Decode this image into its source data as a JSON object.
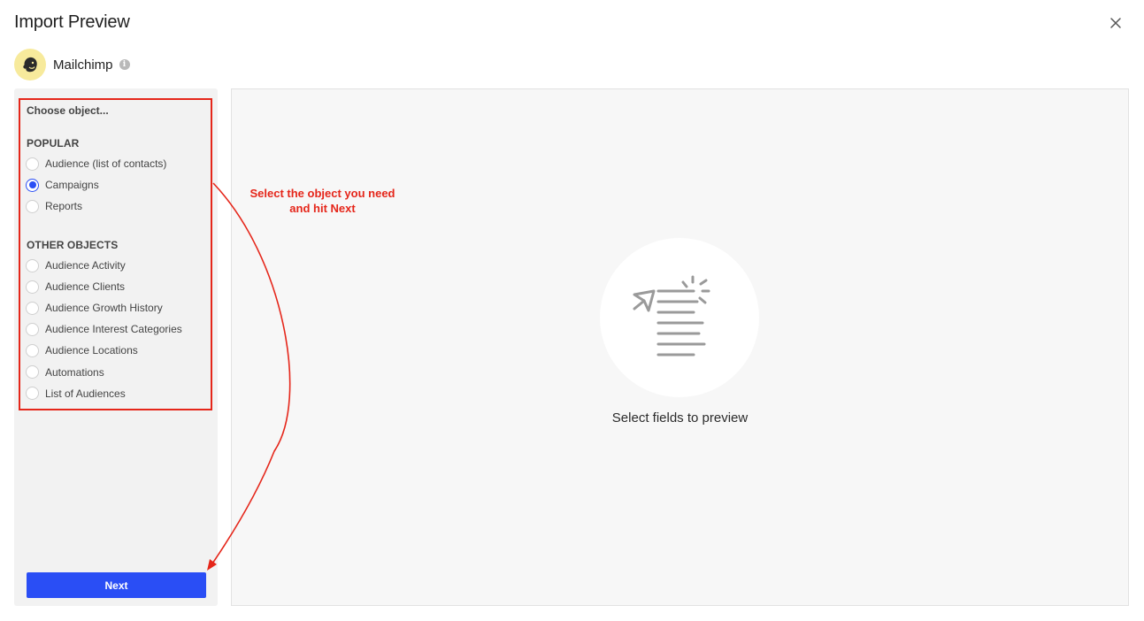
{
  "dialog": {
    "title": "Import Preview",
    "close_icon": "close-icon"
  },
  "source": {
    "name": "Mailchimp",
    "avatar_icon": "mailchimp-logo-icon",
    "info_icon": "info-icon",
    "info_glyph": "i"
  },
  "sidebar": {
    "choose_label": "Choose object...",
    "popular_heading": "POPULAR",
    "popular_options": [
      {
        "label": "Audience (list of contacts)",
        "selected": false
      },
      {
        "label": "Campaigns",
        "selected": true
      },
      {
        "label": "Reports",
        "selected": false
      }
    ],
    "other_heading": "OTHER OBJECTS",
    "other_options": [
      {
        "label": "Audience Activity",
        "selected": false
      },
      {
        "label": "Audience Clients",
        "selected": false
      },
      {
        "label": "Audience Growth History",
        "selected": false
      },
      {
        "label": "Audience Interest Categories",
        "selected": false
      },
      {
        "label": "Audience Locations",
        "selected": false
      },
      {
        "label": "Automations",
        "selected": false
      },
      {
        "label": "List of Audiences",
        "selected": false
      }
    ],
    "next_label": "Next"
  },
  "preview": {
    "empty_icon": "document-send-icon",
    "empty_text": "Select fields to preview"
  },
  "annotation": {
    "line1": "Select the object you need",
    "line2": "and hit Next"
  },
  "colors": {
    "accent": "#2a4ef5",
    "annotation_red": "#e5261a",
    "avatar_bg": "#f7ea9c"
  }
}
